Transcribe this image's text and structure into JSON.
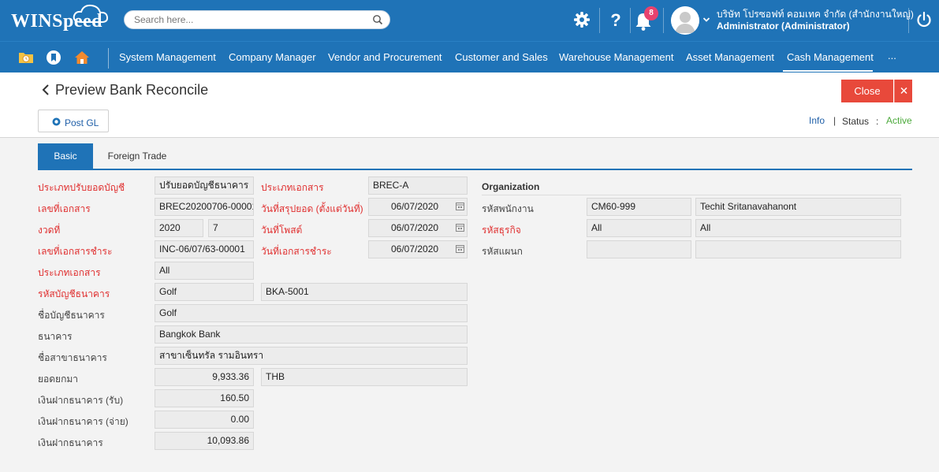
{
  "header": {
    "logo_text": "WINSpeed",
    "search_placeholder": "Search here...",
    "notification_count": "8",
    "company_name": "บริษัท โปรซอฟท์ คอมเทค จำกัด (สำนักงานใหญ่)",
    "user_name": "Administrator (Administrator)"
  },
  "menu": {
    "items": [
      "System Management",
      "Company Manager",
      "Vendor and Procurement",
      "Customer and Sales",
      "Warehouse Management",
      "Asset Management",
      "Cash Management",
      "..."
    ],
    "active": "Cash Management"
  },
  "page": {
    "title": "Preview Bank Reconcile",
    "close_label": "Close",
    "post_gl_label": "Post GL",
    "info_label": "Info",
    "separator": "|",
    "status_label": "Status",
    "status_colon": ":",
    "status_value": "Active"
  },
  "tabs": [
    "Basic",
    "Foreign Trade"
  ],
  "form": {
    "labels": {
      "recon_type": "ประเภทปรับยอดบัญชี",
      "doc_type": "ประเภทเอกสาร",
      "doc_no": "เลขที่เอกสาร",
      "balance_date": "วันที่สรุปยอด (ตั้งแต่วันที่)",
      "period": "งวดที่",
      "post_date": "วันที่โพสต์",
      "pay_doc_no": "เลขที่เอกสารชำระ",
      "pay_doc_date": "วันที่เอกสารชำระ",
      "doc_category": "ประเภทเอกสาร",
      "bank_account_code": "รหัสบัญชีธนาคาร",
      "bank_account_name": "ชื่อบัญชีธนาคาร",
      "bank": "ธนาคาร",
      "bank_branch": "ชื่อสาขาธนาคาร",
      "brought_forward": "ยอดยกมา",
      "deposit_in": "เงินฝากธนาคาร (รับ)",
      "deposit_out": "เงินฝากธนาคาร (จ่าย)",
      "deposit_balance": "เงินฝากธนาคาร"
    },
    "values": {
      "recon_type": "ปรับยอดบัญชีธนาคาร",
      "doc_type": "BREC-A",
      "doc_no": "BREC20200706-00001",
      "balance_date": "06/07/2020",
      "period_year": "2020",
      "period_month": "7",
      "post_date": "06/07/2020",
      "pay_doc_no": "INC-06/07/63-00001",
      "pay_doc_date": "06/07/2020",
      "doc_category": "All",
      "bank_account_code": "Golf",
      "bank_account_code2": "BKA-5001",
      "bank_account_name": "Golf",
      "bank": "Bangkok Bank",
      "bank_branch": "สาขาเซ็นทรัล รามอินทรา",
      "brought_forward": "9,933.36",
      "currency": "THB",
      "deposit_in": "160.50",
      "deposit_out": "0.00",
      "deposit_balance": "10,093.86"
    }
  },
  "organization": {
    "heading": "Organization",
    "labels": {
      "employee": "รหัสพนักงาน",
      "business": "รหัสธุรกิจ",
      "department": "รหัสแผนก"
    },
    "values": {
      "employee_code": "CM60-999",
      "employee_name": "Techit Sritanavahanont",
      "business_code": "All",
      "business_name": "All",
      "department_code": "",
      "department_name": ""
    }
  },
  "colors": {
    "header_bg": "#1f73b7",
    "close_bg": "#e8493b",
    "required_label": "#e03030",
    "status_active": "#4caa3c",
    "badge": "#e8426e"
  },
  "icons": [
    "cloud-icon",
    "search-icon",
    "gear-icon",
    "help-icon",
    "bell-icon",
    "user-avatar-icon",
    "chevron-down-icon",
    "power-icon",
    "folder-clock-icon",
    "bookmark-icon",
    "home-icon",
    "back-chevron-icon",
    "close-x-icon",
    "post-icon",
    "calendar-icon"
  ]
}
